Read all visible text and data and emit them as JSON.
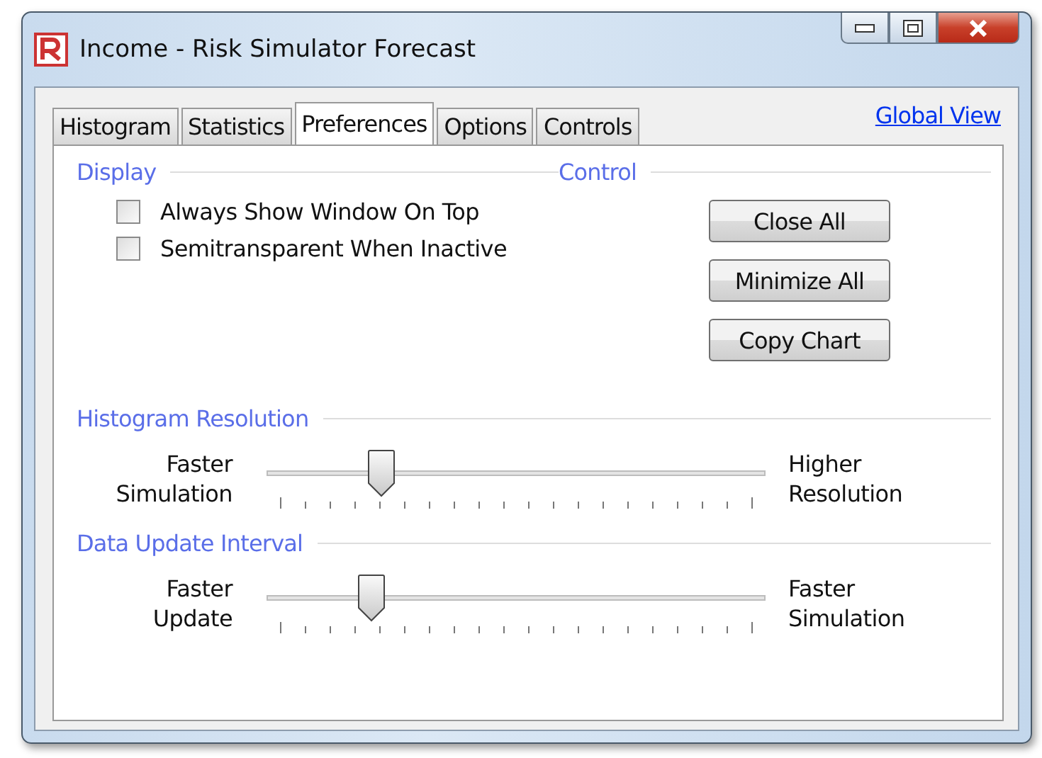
{
  "window": {
    "title": "Income - Risk Simulator Forecast"
  },
  "tabs": [
    {
      "label": "Histogram",
      "selected": false
    },
    {
      "label": "Statistics",
      "selected": false
    },
    {
      "label": "Preferences",
      "selected": true
    },
    {
      "label": "Options",
      "selected": false
    },
    {
      "label": "Controls",
      "selected": false
    }
  ],
  "global_view_link": "Global View",
  "display": {
    "heading": "Display",
    "options": [
      {
        "label": "Always Show Window On Top",
        "checked": false
      },
      {
        "label": "Semitransparent When Inactive",
        "checked": false
      }
    ]
  },
  "control": {
    "heading": "Control",
    "buttons": [
      "Close All",
      "Minimize All",
      "Copy Chart"
    ]
  },
  "sliders": [
    {
      "heading": "Histogram Resolution",
      "left": [
        "Faster",
        "Simulation"
      ],
      "right": [
        "Higher",
        "Resolution"
      ],
      "level": 0.23
    },
    {
      "heading": "Data Update Interval",
      "left": [
        "Faster",
        "Update"
      ],
      "right": [
        "Faster",
        "Simulation"
      ],
      "level": 0.21
    }
  ]
}
